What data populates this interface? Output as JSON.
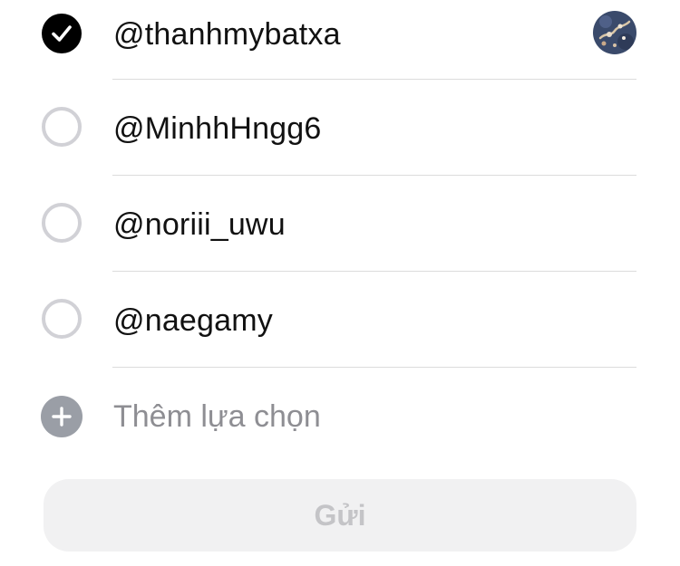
{
  "poll": {
    "options": [
      {
        "label": "@thanhmybatxa",
        "selected": true,
        "icon": "checkmark-icon",
        "has_avatar": true
      },
      {
        "label": "@MinhhHngg6",
        "selected": false
      },
      {
        "label": "@noriii_uwu",
        "selected": false
      },
      {
        "label": "@naegamy",
        "selected": false
      }
    ],
    "add_option": {
      "icon": "plus-icon",
      "label": "Thêm lựa chọn"
    },
    "send_button": {
      "label": "Gửi",
      "enabled": false
    }
  },
  "colors": {
    "checked_fill": "#000000",
    "unchecked_border": "#d1d1d6",
    "add_icon": "#9a9ea6",
    "placeholder_text": "#8e8e93",
    "button_bg": "#f1f1f2",
    "button_text_disabled": "#c4c4c7"
  }
}
